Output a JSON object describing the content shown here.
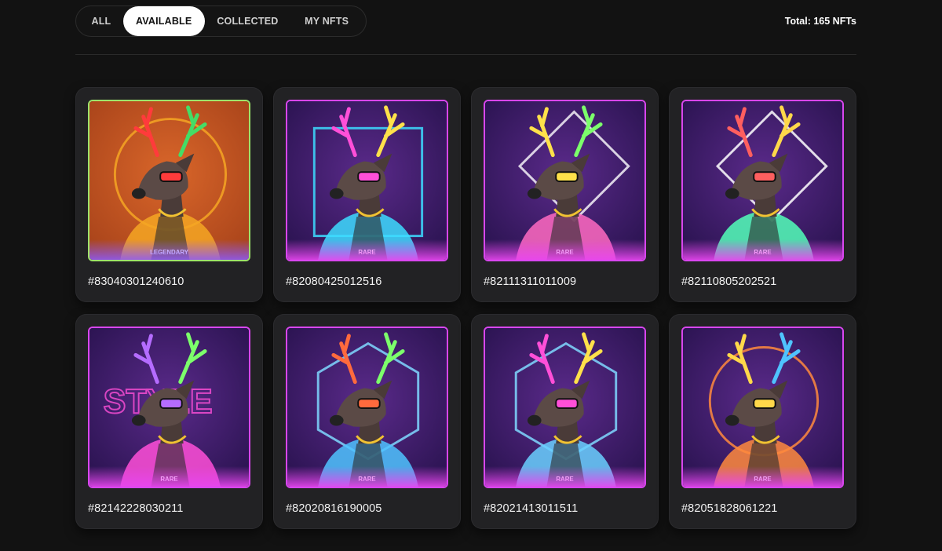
{
  "tabs": {
    "all": "ALL",
    "available": "AVAILABLE",
    "collected": "COLLECTED",
    "my_nfts": "MY NFTS",
    "active": "AVAILABLE"
  },
  "total_label": "Total: 165 NFTs",
  "colors": {
    "background": "#121212",
    "card": "#222224",
    "rare_border": "#d946ef",
    "legendary_border": "#9ee36a"
  },
  "nfts": [
    {
      "id": "#83040301240610",
      "rarity": "LEGENDARY",
      "bg": "orange"
    },
    {
      "id": "#82080425012516",
      "rarity": "RARE",
      "bg": "purple"
    },
    {
      "id": "#82111311011009",
      "rarity": "RARE",
      "bg": "purple"
    },
    {
      "id": "#82110805202521",
      "rarity": "RARE",
      "bg": "purple"
    },
    {
      "id": "#82142228030211",
      "rarity": "RARE",
      "bg": "purple"
    },
    {
      "id": "#82020816190005",
      "rarity": "RARE",
      "bg": "purple"
    },
    {
      "id": "#82021413011511",
      "rarity": "RARE",
      "bg": "purple"
    },
    {
      "id": "#82051828061221",
      "rarity": "RARE",
      "bg": "purple"
    }
  ]
}
